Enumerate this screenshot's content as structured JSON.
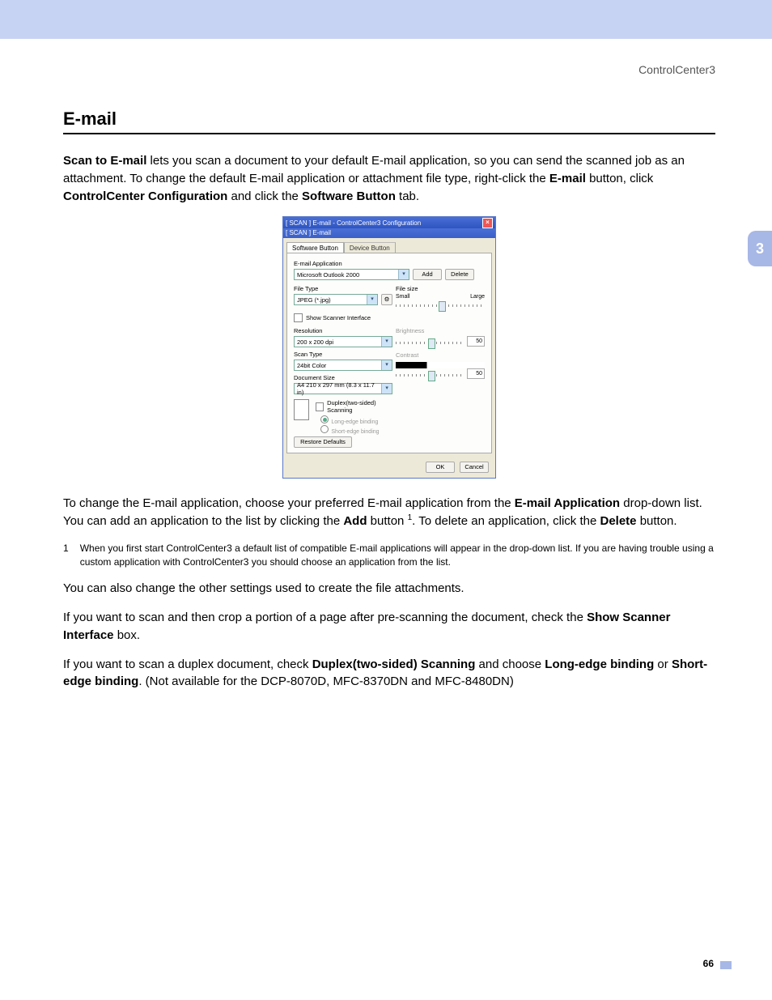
{
  "header": {
    "breadcrumb": "ControlCenter3"
  },
  "sideTab": "3",
  "pageNumber": "66",
  "section": {
    "title": "E-mail",
    "intro_lead": "Scan to E-mail",
    "intro_rest": " lets you scan a document to your default E-mail application, so you can send the scanned job as an attachment. To change the default E-mail application or attachment file type, right-click the ",
    "intro_bold1": "E-mail",
    "intro_mid": " button, click ",
    "intro_bold2": "ControlCenter Configuration",
    "intro_mid2": " and click the ",
    "intro_bold3": "Software Button",
    "intro_end": " tab."
  },
  "para2": {
    "p1": "To change the E-mail application, choose your preferred E-mail application from the ",
    "b1": "E-mail Application",
    "p2": " drop-down list. You can add an application to the list by clicking the ",
    "b2": "Add",
    "p3": " button ",
    "sup": "1",
    "p4": ". To delete an application, click the ",
    "b3": "Delete",
    "p5": " button."
  },
  "footnote": {
    "num": "1",
    "text": "When you first start ControlCenter3 a default list of compatible E-mail applications will appear in the drop-down list. If you are having trouble using a custom application with ControlCenter3 you should choose an application from the list."
  },
  "para3": "You can also change the other settings used to create the file attachments.",
  "para4": {
    "p1": "If you want to scan and then crop a portion of a page after pre-scanning the document, check the ",
    "b1": "Show Scanner Interface",
    "p2": " box."
  },
  "para5": {
    "p1": "If you want to scan a duplex document, check ",
    "b1": "Duplex(two-sided) Scanning",
    "p2": " and choose ",
    "b2": "Long-edge binding",
    "p3": " or ",
    "b3": "Short-edge binding",
    "p4": ". (Not available for the DCP-8070D, MFC-8370DN and MFC-8480DN)"
  },
  "dialog": {
    "title": "[ SCAN ]   E-mail - ControlCenter3 Configuration",
    "subtitle": "[ SCAN ]   E-mail",
    "tabs": {
      "software": "Software Button",
      "device": "Device Button"
    },
    "emailAppLabel": "E-mail Application",
    "emailAppValue": "Microsoft Outlook 2000",
    "addBtn": "Add",
    "deleteBtn": "Delete",
    "fileTypeLabel": "File Type",
    "fileTypeValue": "JPEG (*.jpg)",
    "fileSizeLabel": "File size",
    "fileSizeSmall": "Small",
    "fileSizeLarge": "Large",
    "showScanner": "Show Scanner Interface",
    "resolutionLabel": "Resolution",
    "resolutionValue": "200 x 200 dpi",
    "scanTypeLabel": "Scan Type",
    "scanTypeValue": "24bit Color",
    "docSizeLabel": "Document Size",
    "docSizeValue": "A4 210 x 297 mm (8.3 x 11.7 in)",
    "brightnessLabel": "Brightness",
    "brightnessValue": "50",
    "contrastLabel": "Contrast",
    "contrastValue": "50",
    "duplexLabel": "Duplex(two-sided) Scanning",
    "longEdge": "Long-edge binding",
    "shortEdge": "Short-edge binding",
    "restore": "Restore Defaults",
    "ok": "OK",
    "cancel": "Cancel"
  }
}
